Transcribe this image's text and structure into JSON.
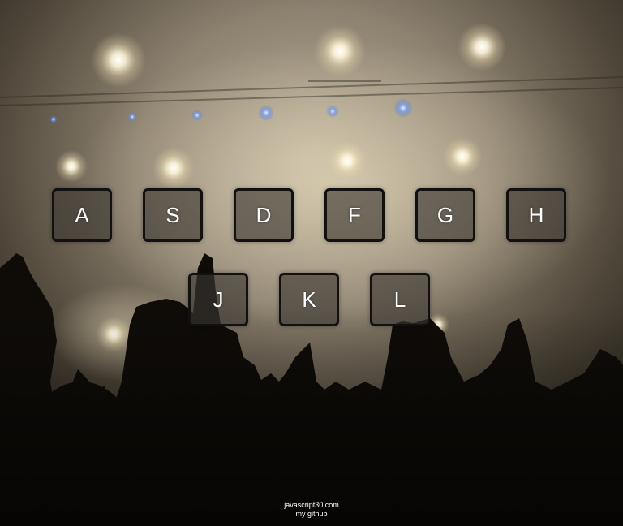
{
  "keys_row_1": [
    {
      "label": "A"
    },
    {
      "label": "S"
    },
    {
      "label": "D"
    },
    {
      "label": "F"
    },
    {
      "label": "G"
    },
    {
      "label": "H"
    }
  ],
  "keys_row_2": [
    {
      "label": "J"
    },
    {
      "label": "K"
    },
    {
      "label": "L"
    }
  ],
  "footer": {
    "site_link": "javascript30.com",
    "github_link": "my github"
  },
  "colors": {
    "key_text": "#ffffff",
    "key_border": "#111111",
    "key_fill": "#3c3732"
  }
}
